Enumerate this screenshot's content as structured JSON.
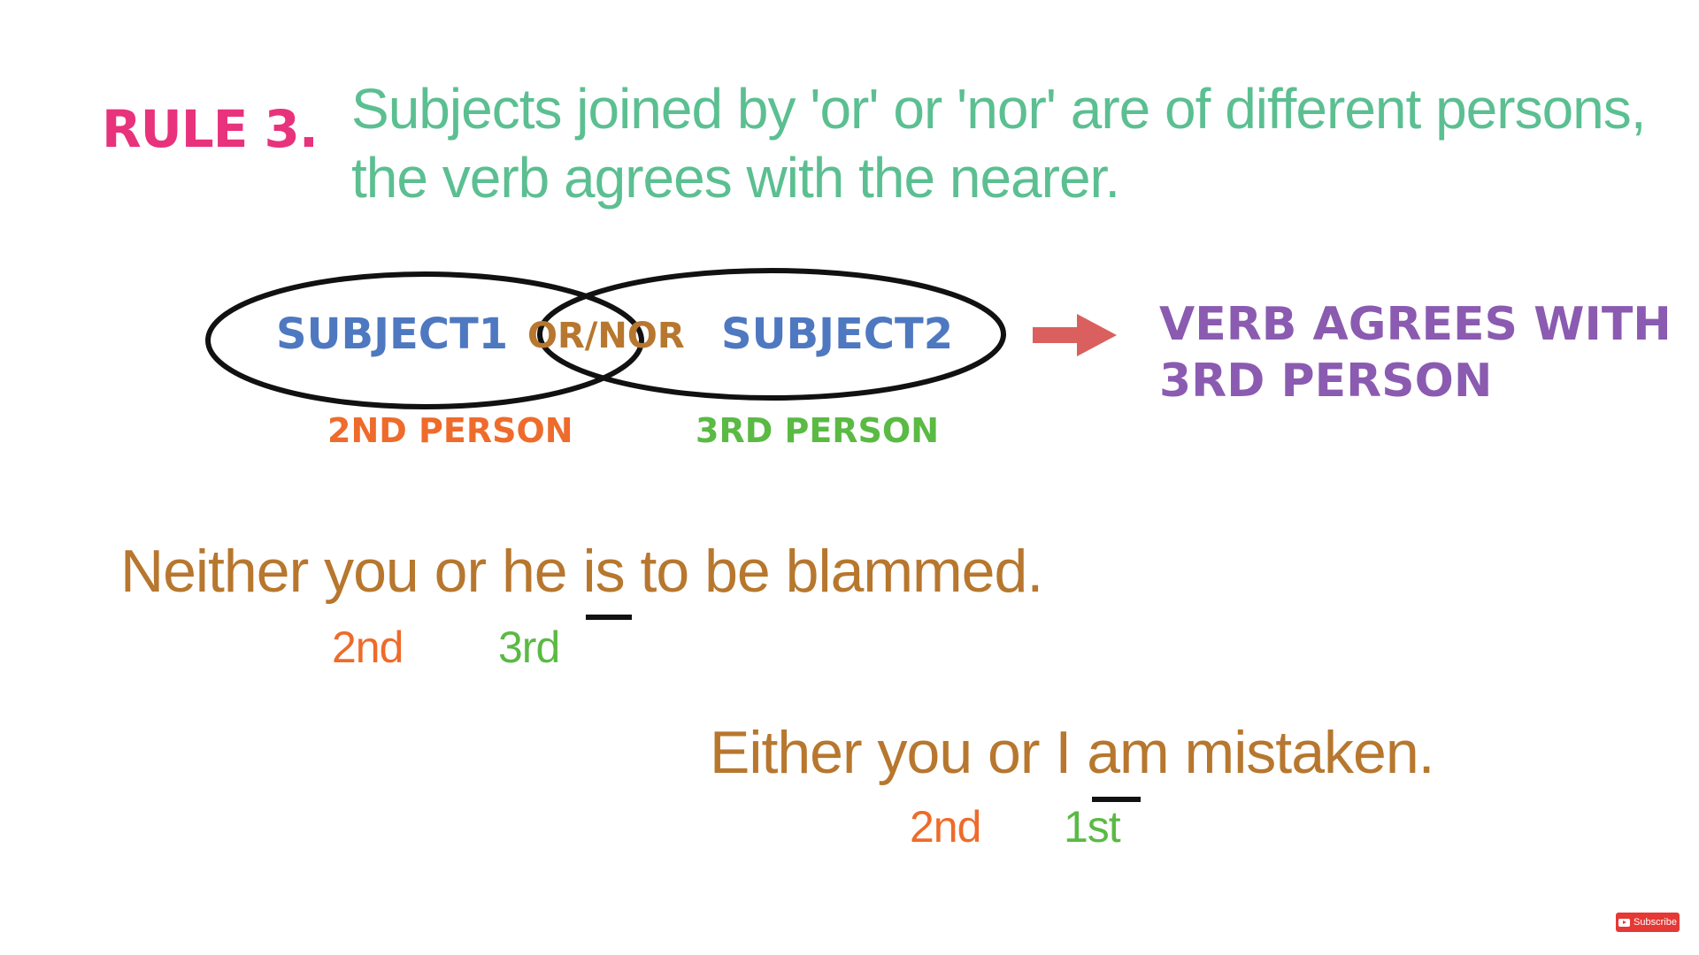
{
  "rule": {
    "label": "RULE 3.",
    "text_line1": "Subjects joined by 'or' or 'nor' are of different persons,",
    "text_line2": "the verb agrees with the nearer."
  },
  "diagram": {
    "subject1": "SUBJECT1",
    "connector": "OR/NOR",
    "subject2": "SUBJECT2",
    "subject1_person": "2ND PERSON",
    "subject2_person": "3RD PERSON",
    "result_line1": "VERB AGREES WITH",
    "result_line2": "3RD PERSON",
    "arrow_icon": "right-arrow-icon"
  },
  "examples": [
    {
      "sentence": "Neither you or he is to be blammed.",
      "verb": "is",
      "first_person_tag": "2nd",
      "second_person_tag": "3rd"
    },
    {
      "sentence": "Either you or I am mistaken.",
      "verb": "am",
      "first_person_tag": "2nd",
      "second_person_tag": "1st"
    }
  ],
  "subscribe": {
    "label": "Subscribe",
    "icon": "youtube-play-icon"
  },
  "colors": {
    "rule_label": "#e8327c",
    "rule_text": "#5bbf91",
    "subject": "#4e78c0",
    "connector": "#b7772e",
    "second_person": "#ee6b2b",
    "third_person": "#5aba44",
    "result": "#8a5bb0",
    "arrow": "#d9605f",
    "example": "#b7772e"
  }
}
